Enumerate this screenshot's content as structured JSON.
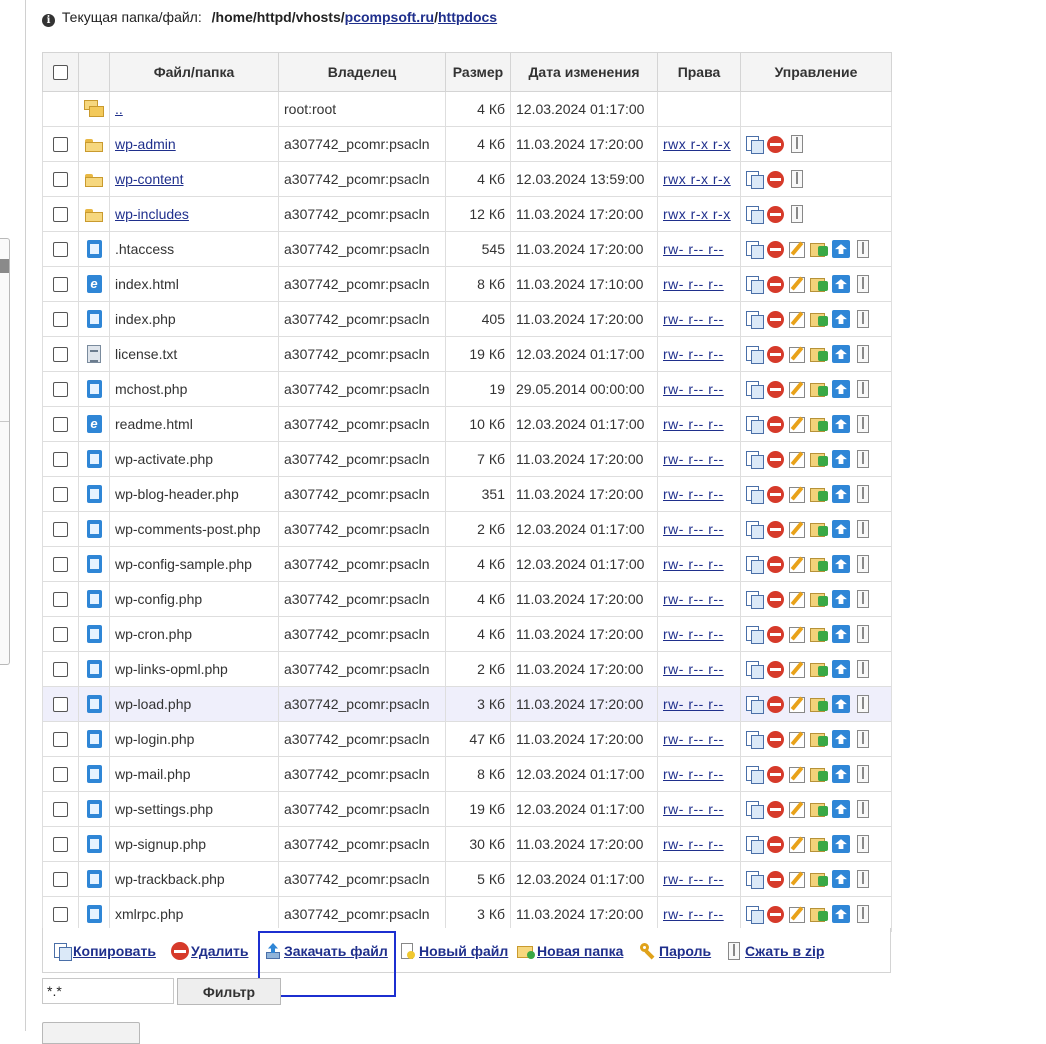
{
  "path": {
    "label": "Текущая папка/файл:",
    "prefix": "/home/httpd/vhosts/",
    "domain": "pcompsoft.ru",
    "sep": "/",
    "dir": "httpdocs"
  },
  "table": {
    "headers": {
      "name": "Файл/папка",
      "owner": "Владелец",
      "size": "Размер",
      "date": "Дата изменения",
      "perms": "Права",
      "manage": "Управление"
    },
    "parent": {
      "name": "..",
      "owner": "root:root",
      "size": "4 Кб",
      "date": "12.03.2024 01:17:00"
    },
    "rows": [
      {
        "type": "folder",
        "name": "wp-admin",
        "owner": "a307742_pcomr:psacln",
        "size": "4 Кб",
        "date": "11.03.2024 17:20:00",
        "perms": "rwx r-x r-x"
      },
      {
        "type": "folder",
        "name": "wp-content",
        "owner": "a307742_pcomr:psacln",
        "size": "4 Кб",
        "date": "12.03.2024 13:59:00",
        "perms": "rwx r-x r-x"
      },
      {
        "type": "folder",
        "name": "wp-includes",
        "owner": "a307742_pcomr:psacln",
        "size": "12 Кб",
        "date": "11.03.2024 17:20:00",
        "perms": "rwx r-x r-x"
      },
      {
        "type": "file",
        "name": ".htaccess",
        "owner": "a307742_pcomr:psacln",
        "size": "545",
        "date": "11.03.2024 17:20:00",
        "perms": "rw- r-- r--"
      },
      {
        "type": "html",
        "name": "index.html",
        "owner": "a307742_pcomr:psacln",
        "size": "8 Кб",
        "date": "11.03.2024 17:10:00",
        "perms": "rw- r-- r--"
      },
      {
        "type": "file",
        "name": "index.php",
        "owner": "a307742_pcomr:psacln",
        "size": "405",
        "date": "11.03.2024 17:20:00",
        "perms": "rw- r-- r--"
      },
      {
        "type": "txt",
        "name": "license.txt",
        "owner": "a307742_pcomr:psacln",
        "size": "19 Кб",
        "date": "12.03.2024 01:17:00",
        "perms": "rw- r-- r--"
      },
      {
        "type": "file",
        "name": "mchost.php",
        "owner": "a307742_pcomr:psacln",
        "size": "19",
        "date": "29.05.2014 00:00:00",
        "perms": "rw- r-- r--"
      },
      {
        "type": "html",
        "name": "readme.html",
        "owner": "a307742_pcomr:psacln",
        "size": "10 Кб",
        "date": "12.03.2024 01:17:00",
        "perms": "rw- r-- r--"
      },
      {
        "type": "file",
        "name": "wp-activate.php",
        "owner": "a307742_pcomr:psacln",
        "size": "7 Кб",
        "date": "11.03.2024 17:20:00",
        "perms": "rw- r-- r--"
      },
      {
        "type": "file",
        "name": "wp-blog-header.php",
        "owner": "a307742_pcomr:psacln",
        "size": "351",
        "date": "11.03.2024 17:20:00",
        "perms": "rw- r-- r--"
      },
      {
        "type": "file",
        "name": "wp-comments-post.php",
        "owner": "a307742_pcomr:psacln",
        "size": "2 Кб",
        "date": "12.03.2024 01:17:00",
        "perms": "rw- r-- r--"
      },
      {
        "type": "file",
        "name": "wp-config-sample.php",
        "owner": "a307742_pcomr:psacln",
        "size": "4 Кб",
        "date": "12.03.2024 01:17:00",
        "perms": "rw- r-- r--"
      },
      {
        "type": "file",
        "name": "wp-config.php",
        "owner": "a307742_pcomr:psacln",
        "size": "4 Кб",
        "date": "11.03.2024 17:20:00",
        "perms": "rw- r-- r--"
      },
      {
        "type": "file",
        "name": "wp-cron.php",
        "owner": "a307742_pcomr:psacln",
        "size": "4 Кб",
        "date": "11.03.2024 17:20:00",
        "perms": "rw- r-- r--"
      },
      {
        "type": "file",
        "name": "wp-links-opml.php",
        "owner": "a307742_pcomr:psacln",
        "size": "2 Кб",
        "date": "11.03.2024 17:20:00",
        "perms": "rw- r-- r--"
      },
      {
        "type": "file",
        "name": "wp-load.php",
        "owner": "a307742_pcomr:psacln",
        "size": "3 Кб",
        "date": "11.03.2024 17:20:00",
        "perms": "rw- r-- r--",
        "highlight": true
      },
      {
        "type": "file",
        "name": "wp-login.php",
        "owner": "a307742_pcomr:psacln",
        "size": "47 Кб",
        "date": "11.03.2024 17:20:00",
        "perms": "rw- r-- r--"
      },
      {
        "type": "file",
        "name": "wp-mail.php",
        "owner": "a307742_pcomr:psacln",
        "size": "8 Кб",
        "date": "12.03.2024 01:17:00",
        "perms": "rw- r-- r--"
      },
      {
        "type": "file",
        "name": "wp-settings.php",
        "owner": "a307742_pcomr:psacln",
        "size": "19 Кб",
        "date": "12.03.2024 01:17:00",
        "perms": "rw- r-- r--"
      },
      {
        "type": "file",
        "name": "wp-signup.php",
        "owner": "a307742_pcomr:psacln",
        "size": "30 Кб",
        "date": "11.03.2024 17:20:00",
        "perms": "rw- r-- r--"
      },
      {
        "type": "file",
        "name": "wp-trackback.php",
        "owner": "a307742_pcomr:psacln",
        "size": "5 Кб",
        "date": "12.03.2024 01:17:00",
        "perms": "rw- r-- r--"
      },
      {
        "type": "file",
        "name": "xmlrpc.php",
        "owner": "a307742_pcomr:psacln",
        "size": "3 Кб",
        "date": "11.03.2024 17:20:00",
        "perms": "rw- r-- r--"
      }
    ]
  },
  "actions": {
    "copy": "Копировать",
    "delete": "Удалить",
    "upload": "Закачать файл",
    "new_file": "Новый файл",
    "new_folder": "Новая папка",
    "password": "Пароль",
    "zip": "Сжать в zip"
  },
  "filter": {
    "value": "*.*",
    "button": "Фильтр"
  },
  "colors": {
    "link": "#1f2f8c",
    "highlight_row": "#efeffb",
    "highlight_box": "#1c2fd0"
  }
}
